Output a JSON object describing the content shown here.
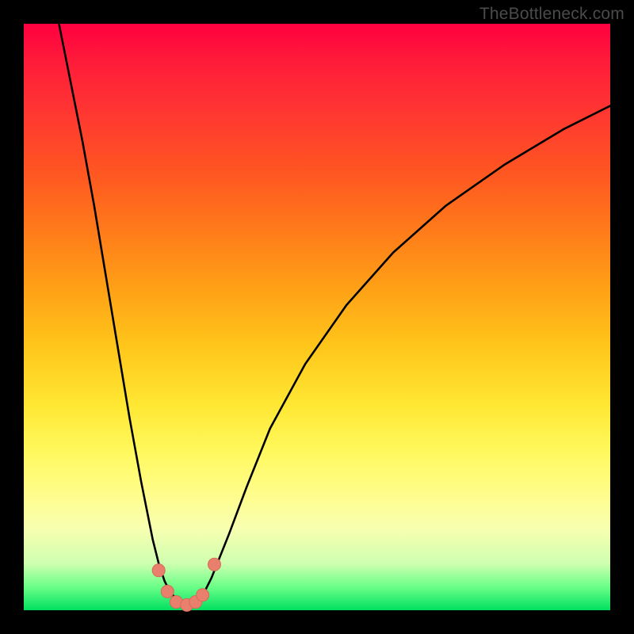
{
  "watermark": "TheBottleneck.com",
  "colors": {
    "bg_black": "#000000",
    "curve_color": "#000000",
    "marker_fill": "#e9806e",
    "marker_stroke": "#d56a58",
    "gradient_top": "#ff0040",
    "gradient_bottom": "#00e060"
  },
  "chart_data": {
    "type": "line",
    "title": "",
    "xlabel": "",
    "ylabel": "",
    "xlim": [
      0,
      100
    ],
    "ylim": [
      0,
      100
    ],
    "grid": false,
    "series": [
      {
        "name": "left-branch",
        "x": [
          6,
          8,
          10,
          12,
          14,
          16,
          18,
          20,
          22,
          23,
          24,
          25,
          26,
          27,
          28
        ],
        "y": [
          100,
          90,
          80,
          69,
          57,
          45,
          33,
          22,
          12,
          8,
          5,
          3,
          2,
          1.2,
          0.8
        ]
      },
      {
        "name": "right-branch",
        "x": [
          28,
          29,
          30,
          31,
          32,
          33,
          35,
          38,
          42,
          48,
          55,
          63,
          72,
          82,
          92,
          100
        ],
        "y": [
          0.8,
          1.2,
          2,
          3.5,
          5.5,
          8,
          13,
          21,
          31,
          42,
          52,
          61,
          69,
          76,
          82,
          86
        ]
      }
    ],
    "markers": {
      "name": "valley-points",
      "x": [
        23.0,
        24.5,
        26.0,
        27.8,
        29.3,
        30.5,
        32.5
      ],
      "y": [
        6.8,
        3.2,
        1.4,
        0.9,
        1.4,
        2.6,
        7.8
      ]
    },
    "note": "x and y in 0-100 domain; y=0 is bottom (green), y=100 is top (red). Values estimated from pixels; no numeric axes shown."
  }
}
